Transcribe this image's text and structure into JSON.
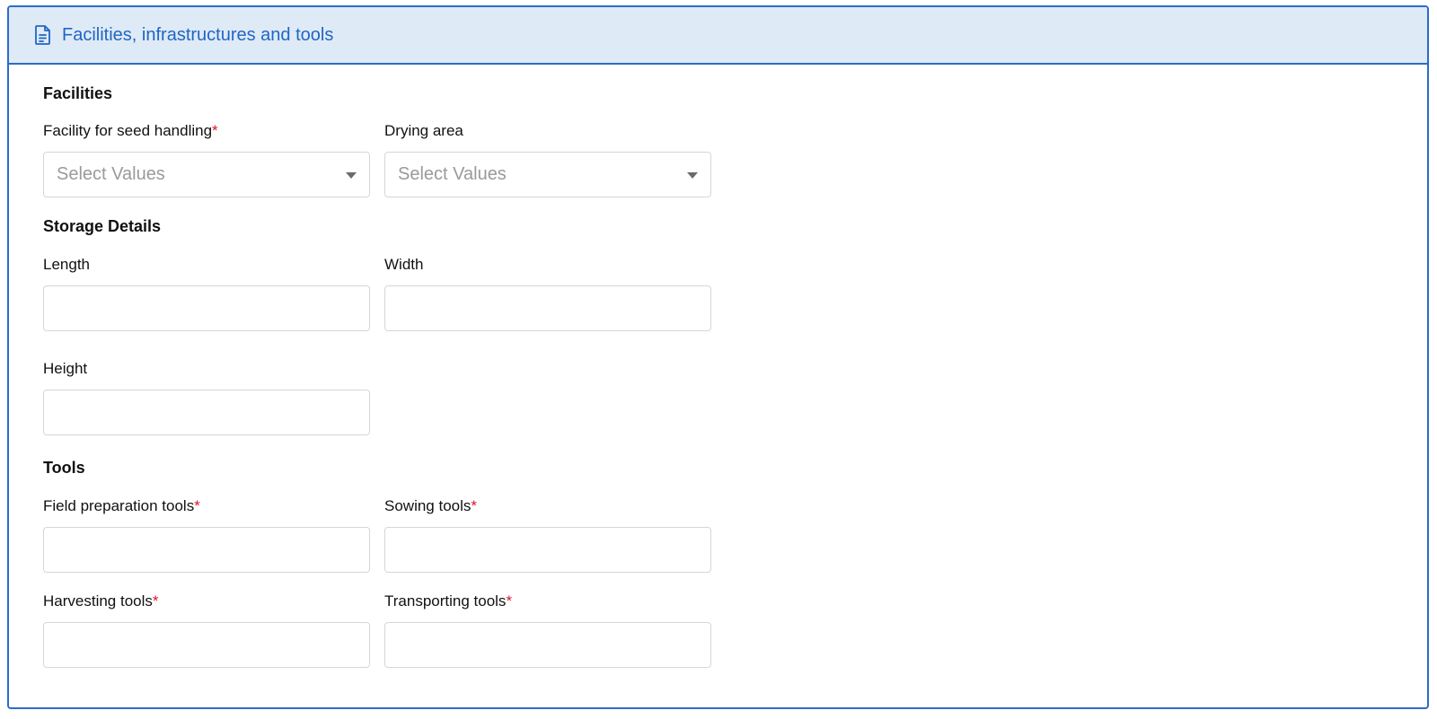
{
  "panel": {
    "title": "Facilities, infrastructures and tools",
    "icon": "document-icon"
  },
  "sections": {
    "facilities": {
      "title": "Facilities",
      "seed_handling": {
        "label": "Facility for seed handling",
        "required_mark": "*",
        "placeholder": "Select Values"
      },
      "drying_area": {
        "label": "Drying area",
        "placeholder": "Select Values"
      }
    },
    "storage": {
      "title": "Storage Details",
      "length": {
        "label": "Length",
        "value": ""
      },
      "width": {
        "label": "Width",
        "value": ""
      },
      "height": {
        "label": "Height",
        "value": ""
      }
    },
    "tools": {
      "title": "Tools",
      "field_preparation": {
        "label": "Field preparation tools",
        "required_mark": "*",
        "value": ""
      },
      "sowing": {
        "label": "Sowing tools",
        "required_mark": "*",
        "value": ""
      },
      "harvesting": {
        "label": "Harvesting tools",
        "required_mark": "*",
        "value": ""
      },
      "transporting": {
        "label": "Transporting tools",
        "required_mark": "*",
        "value": ""
      }
    }
  },
  "colors": {
    "accent": "#2a6cc9",
    "header_bg": "#dfeaf7",
    "required": "#e0122b"
  }
}
